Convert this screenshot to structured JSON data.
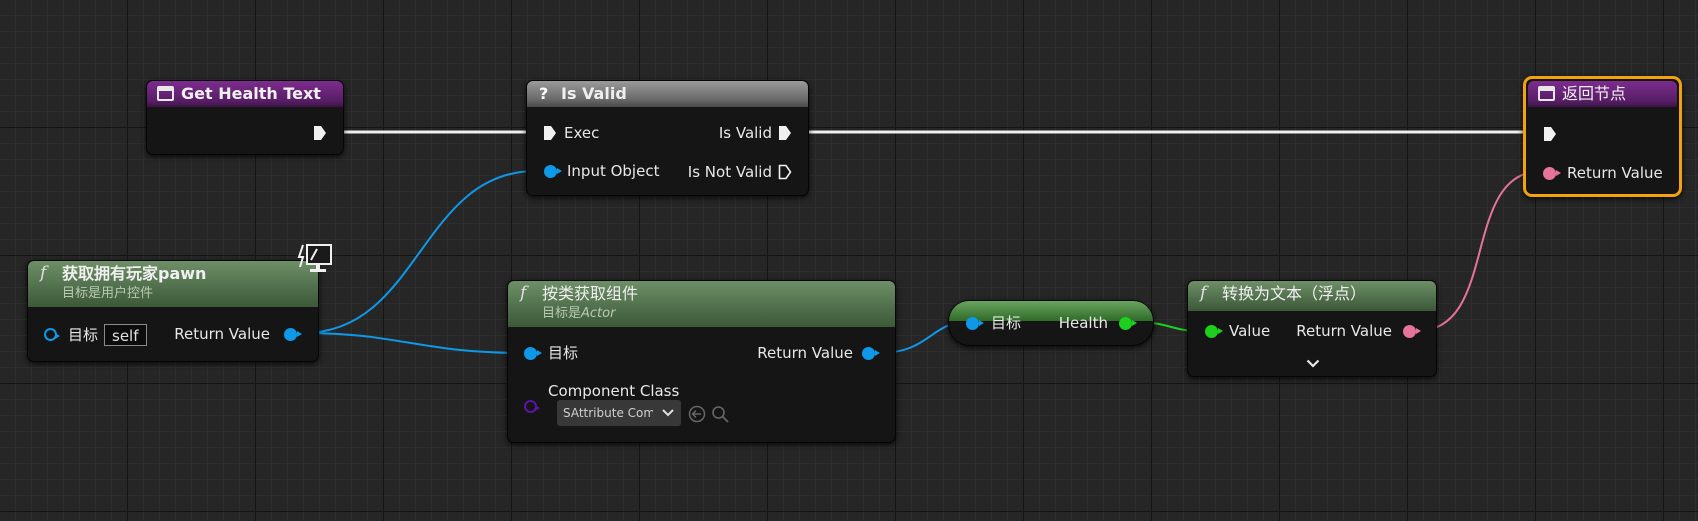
{
  "nodes": {
    "get_health_text": {
      "title": "Get Health Text"
    },
    "is_valid": {
      "title": "Is Valid",
      "exec_in": "Exec",
      "input_object": "Input Object",
      "is_valid_out": "Is Valid",
      "is_not_valid_out": "Is Not Valid"
    },
    "get_owning_pawn": {
      "title": "获取拥有玩家pawn",
      "subtitle": "目标是用户控件",
      "target_label": "目标",
      "target_value": "self",
      "return_label": "Return Value"
    },
    "get_component_by_class": {
      "title": "按类获取组件",
      "subtitle_prefix": "目标是",
      "subtitle_class": "Actor",
      "target_label": "目标",
      "return_label": "Return Value",
      "component_class_label": "Component Class",
      "component_class_value": "SAttribute Compo"
    },
    "get_health": {
      "target_label": "目标",
      "health_label": "Health"
    },
    "to_text_float": {
      "title": "转换为文本（浮点）",
      "value_label": "Value",
      "return_label": "Return Value"
    },
    "return_node": {
      "title": "返回节点",
      "return_label": "Return Value"
    }
  },
  "colors": {
    "exec_wire": "#f0f0f0",
    "object_wire": "#0f98e8",
    "float_wire": "#1ed01e",
    "text_wire": "#e6739a",
    "selection": "#f2a20f"
  },
  "icons": [
    "function-icon",
    "question-icon",
    "execution-pin-icon",
    "monitor-icon",
    "chevron-down-icon",
    "arrow-back-icon",
    "magnifier-icon"
  ]
}
